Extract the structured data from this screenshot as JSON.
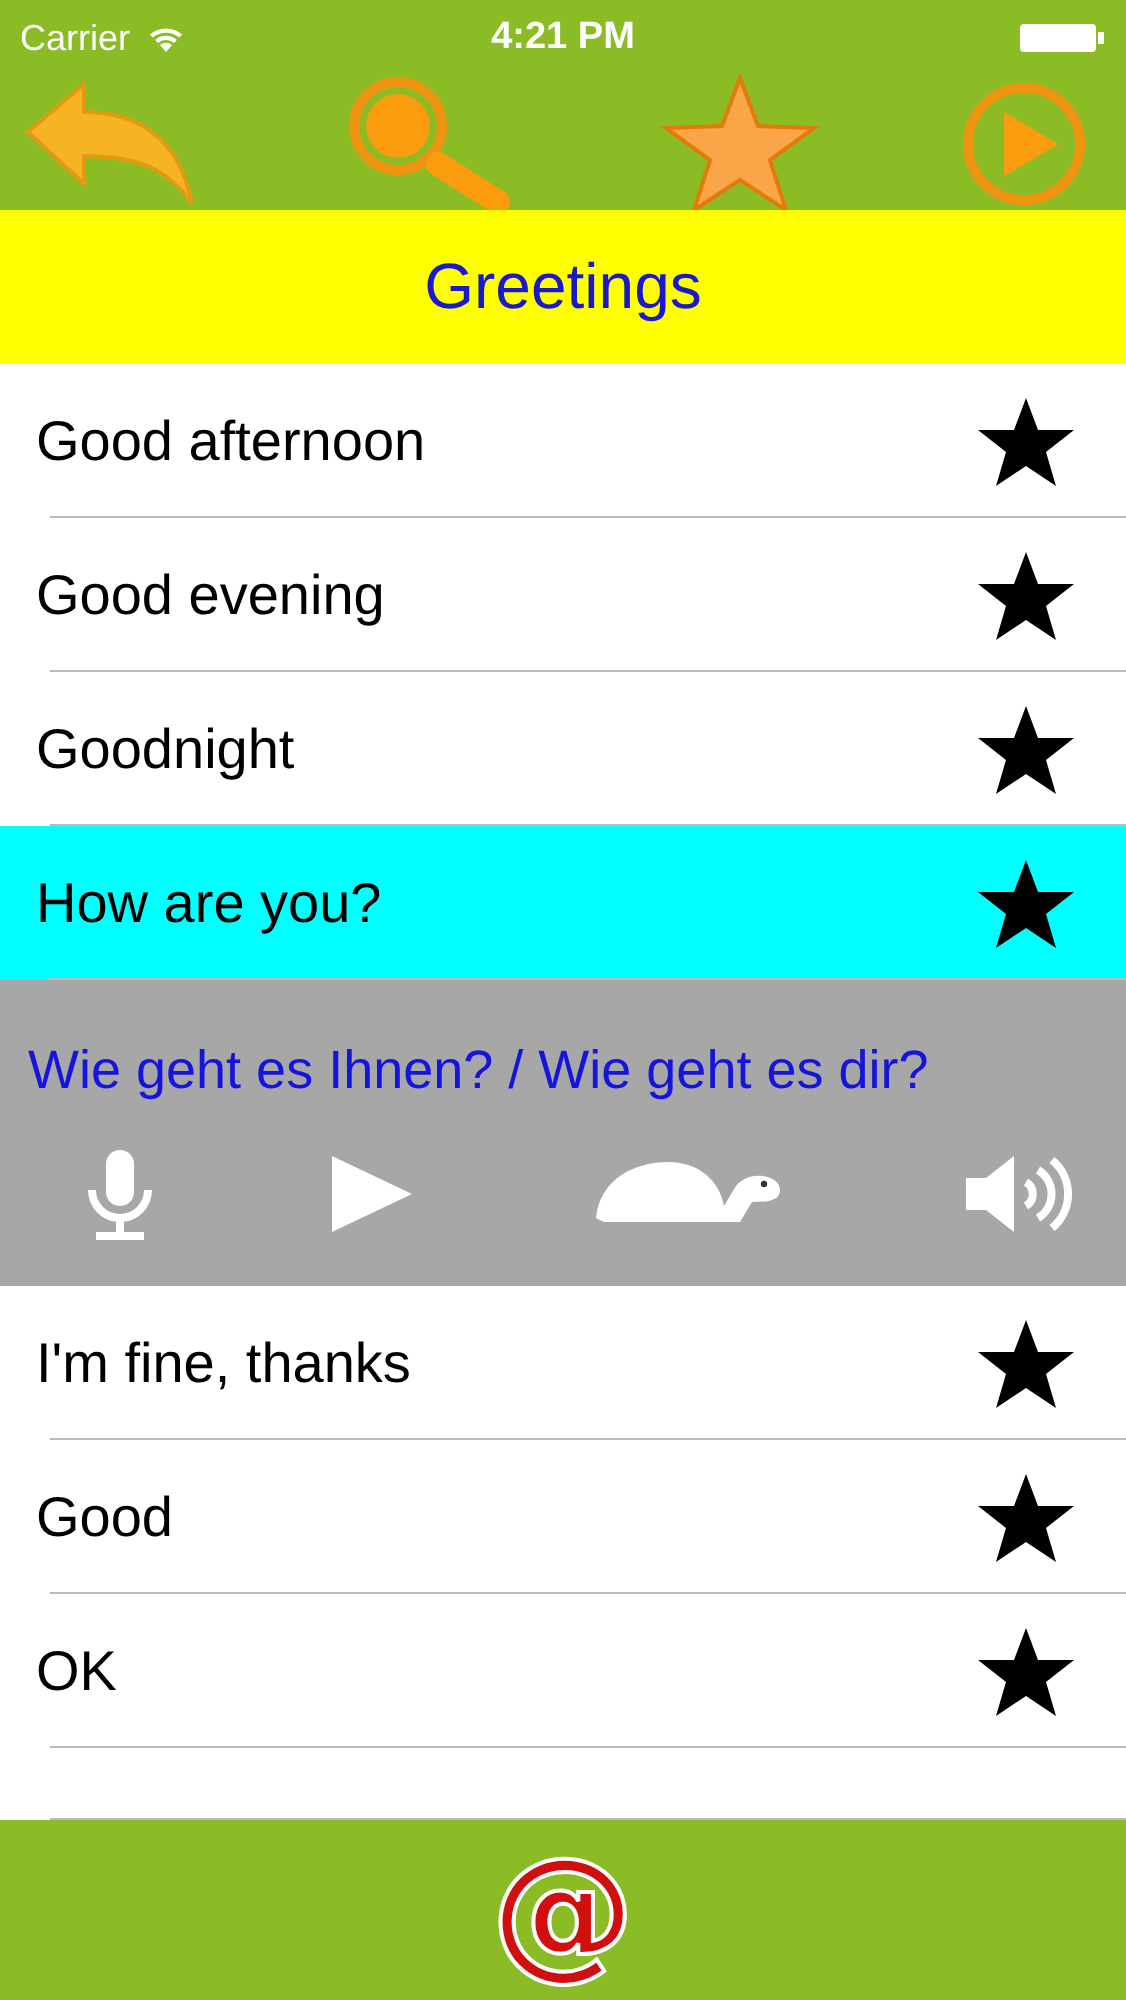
{
  "status_bar": {
    "carrier": "Carrier",
    "time": "4:21 PM"
  },
  "category": {
    "title": "Greetings"
  },
  "phrases": [
    {
      "text": "Good afternoon",
      "selected": false
    },
    {
      "text": "Good evening",
      "selected": false
    },
    {
      "text": "Goodnight",
      "selected": false
    },
    {
      "text": "How are you?",
      "selected": true
    },
    {
      "text": "I'm fine, thanks",
      "selected": false
    },
    {
      "text": "Good",
      "selected": false
    },
    {
      "text": "OK",
      "selected": false
    }
  ],
  "translation": {
    "text": "Wie geht es Ihnen? / Wie geht es dir?"
  },
  "bottom_bar": {
    "email_button": "@"
  }
}
